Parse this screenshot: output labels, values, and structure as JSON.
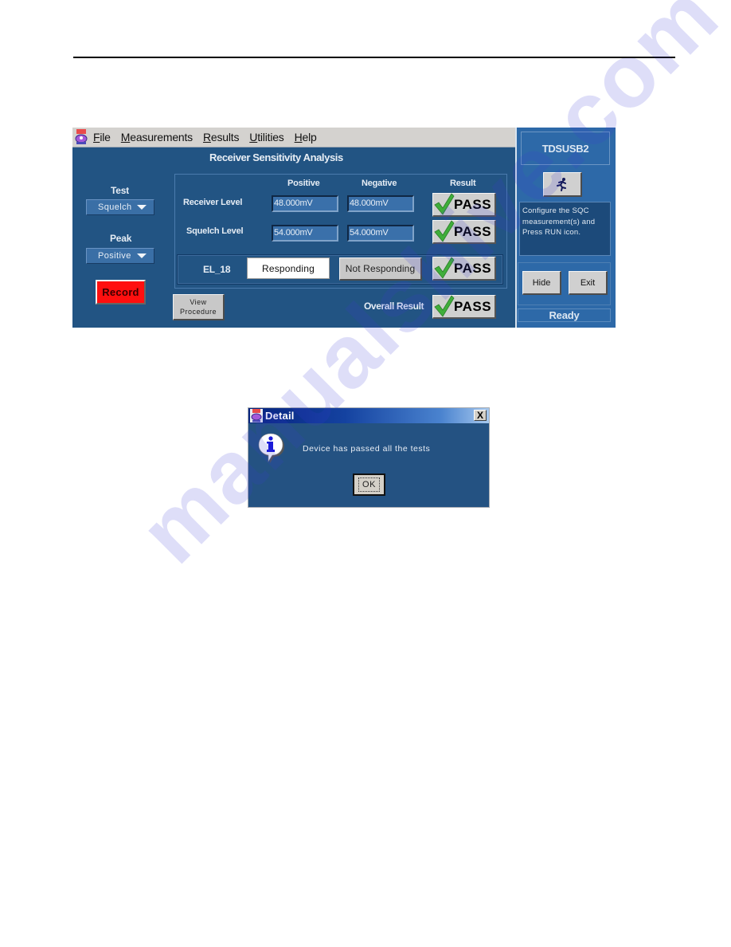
{
  "app": {
    "menu": [
      {
        "label": "File",
        "mnemonic": "F",
        "rest": "ile"
      },
      {
        "label": "Measurements",
        "mnemonic": "M",
        "rest": "easurements"
      },
      {
        "label": "Results",
        "mnemonic": "R",
        "rest": "esults"
      },
      {
        "label": "Utilities",
        "mnemonic": "U",
        "rest": "tilities"
      },
      {
        "label": "Help",
        "mnemonic": "H",
        "rest": "elp"
      }
    ],
    "title": "Receiver Sensitivity Analysis",
    "left_panel": {
      "test_label": "Test",
      "test_value": "Squelch",
      "peak_label": "Peak",
      "peak_value": "Positive",
      "record_label": "Record",
      "record_color": "#ff0f0f"
    },
    "table": {
      "headers": [
        "Positive",
        "Negative",
        "Result"
      ],
      "rows": [
        {
          "label": "Receiver Level",
          "positive": "48.000mV",
          "negative": "48.000mV",
          "result": "PASS"
        },
        {
          "label": "Squelch Level",
          "positive": "54.000mV",
          "negative": "54.000mV",
          "result": "PASS"
        }
      ]
    },
    "el_test": {
      "label": "EL_18",
      "responding_label": "Responding",
      "not_responding_label": "Not Responding",
      "result": "PASS"
    },
    "view_procedure_line1": "View",
    "view_procedure_line2": "Procedure",
    "overall_label": "Overall Result",
    "overall_result": "PASS",
    "side_panel": {
      "product": "TDSUSB2",
      "run_icon": "running-man-icon",
      "message_lines": [
        "Configure the SQC",
        "measurement(s) and",
        "Press RUN icon."
      ],
      "hide_label": "Hide",
      "exit_label": "Exit",
      "status": "Ready"
    },
    "colors": {
      "panel_bg": "#225483",
      "side_bg": "#2d69a8",
      "pass_check": "#3fae3a"
    }
  },
  "dialog": {
    "title": "Detail",
    "close_label": "X",
    "icon": "info-icon",
    "message": "Device has passed all the tests",
    "ok_label": "OK"
  },
  "watermark": "manualshive.com"
}
